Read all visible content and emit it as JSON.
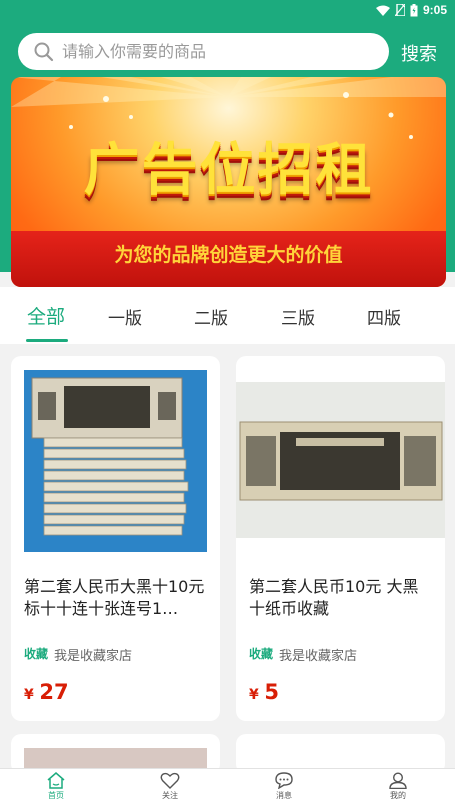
{
  "status_bar": {
    "time": "9:05"
  },
  "search": {
    "placeholder": "请输入你需要的商品",
    "button_label": "搜索"
  },
  "banner": {
    "title": "广告位招租",
    "subtitle": "为您的品牌创造更大的价值"
  },
  "tabs": [
    {
      "label": "全部",
      "active": true
    },
    {
      "label": "一版",
      "active": false
    },
    {
      "label": "二版",
      "active": false
    },
    {
      "label": "三版",
      "active": false
    },
    {
      "label": "四版",
      "active": false
    }
  ],
  "products": [
    {
      "title": "第二套人民币大黑十10元标十十连十张连号1…",
      "tag": "收藏",
      "shop": "我是收藏家店",
      "currency": "¥",
      "price": "27"
    },
    {
      "title": "第二套人民币10元 大黑十纸币收藏",
      "tag": "收藏",
      "shop": "我是收藏家店",
      "currency": "¥",
      "price": "5"
    }
  ],
  "bottom_nav": [
    {
      "label": "首页",
      "icon": "home-icon",
      "active": true
    },
    {
      "label": "关注",
      "icon": "heart-icon",
      "active": false
    },
    {
      "label": "消息",
      "icon": "message-icon",
      "active": false
    },
    {
      "label": "我的",
      "icon": "user-icon",
      "active": false
    }
  ],
  "colors": {
    "accent": "#1cab7e",
    "price": "#d81e06",
    "background": "#f2f2f2"
  }
}
